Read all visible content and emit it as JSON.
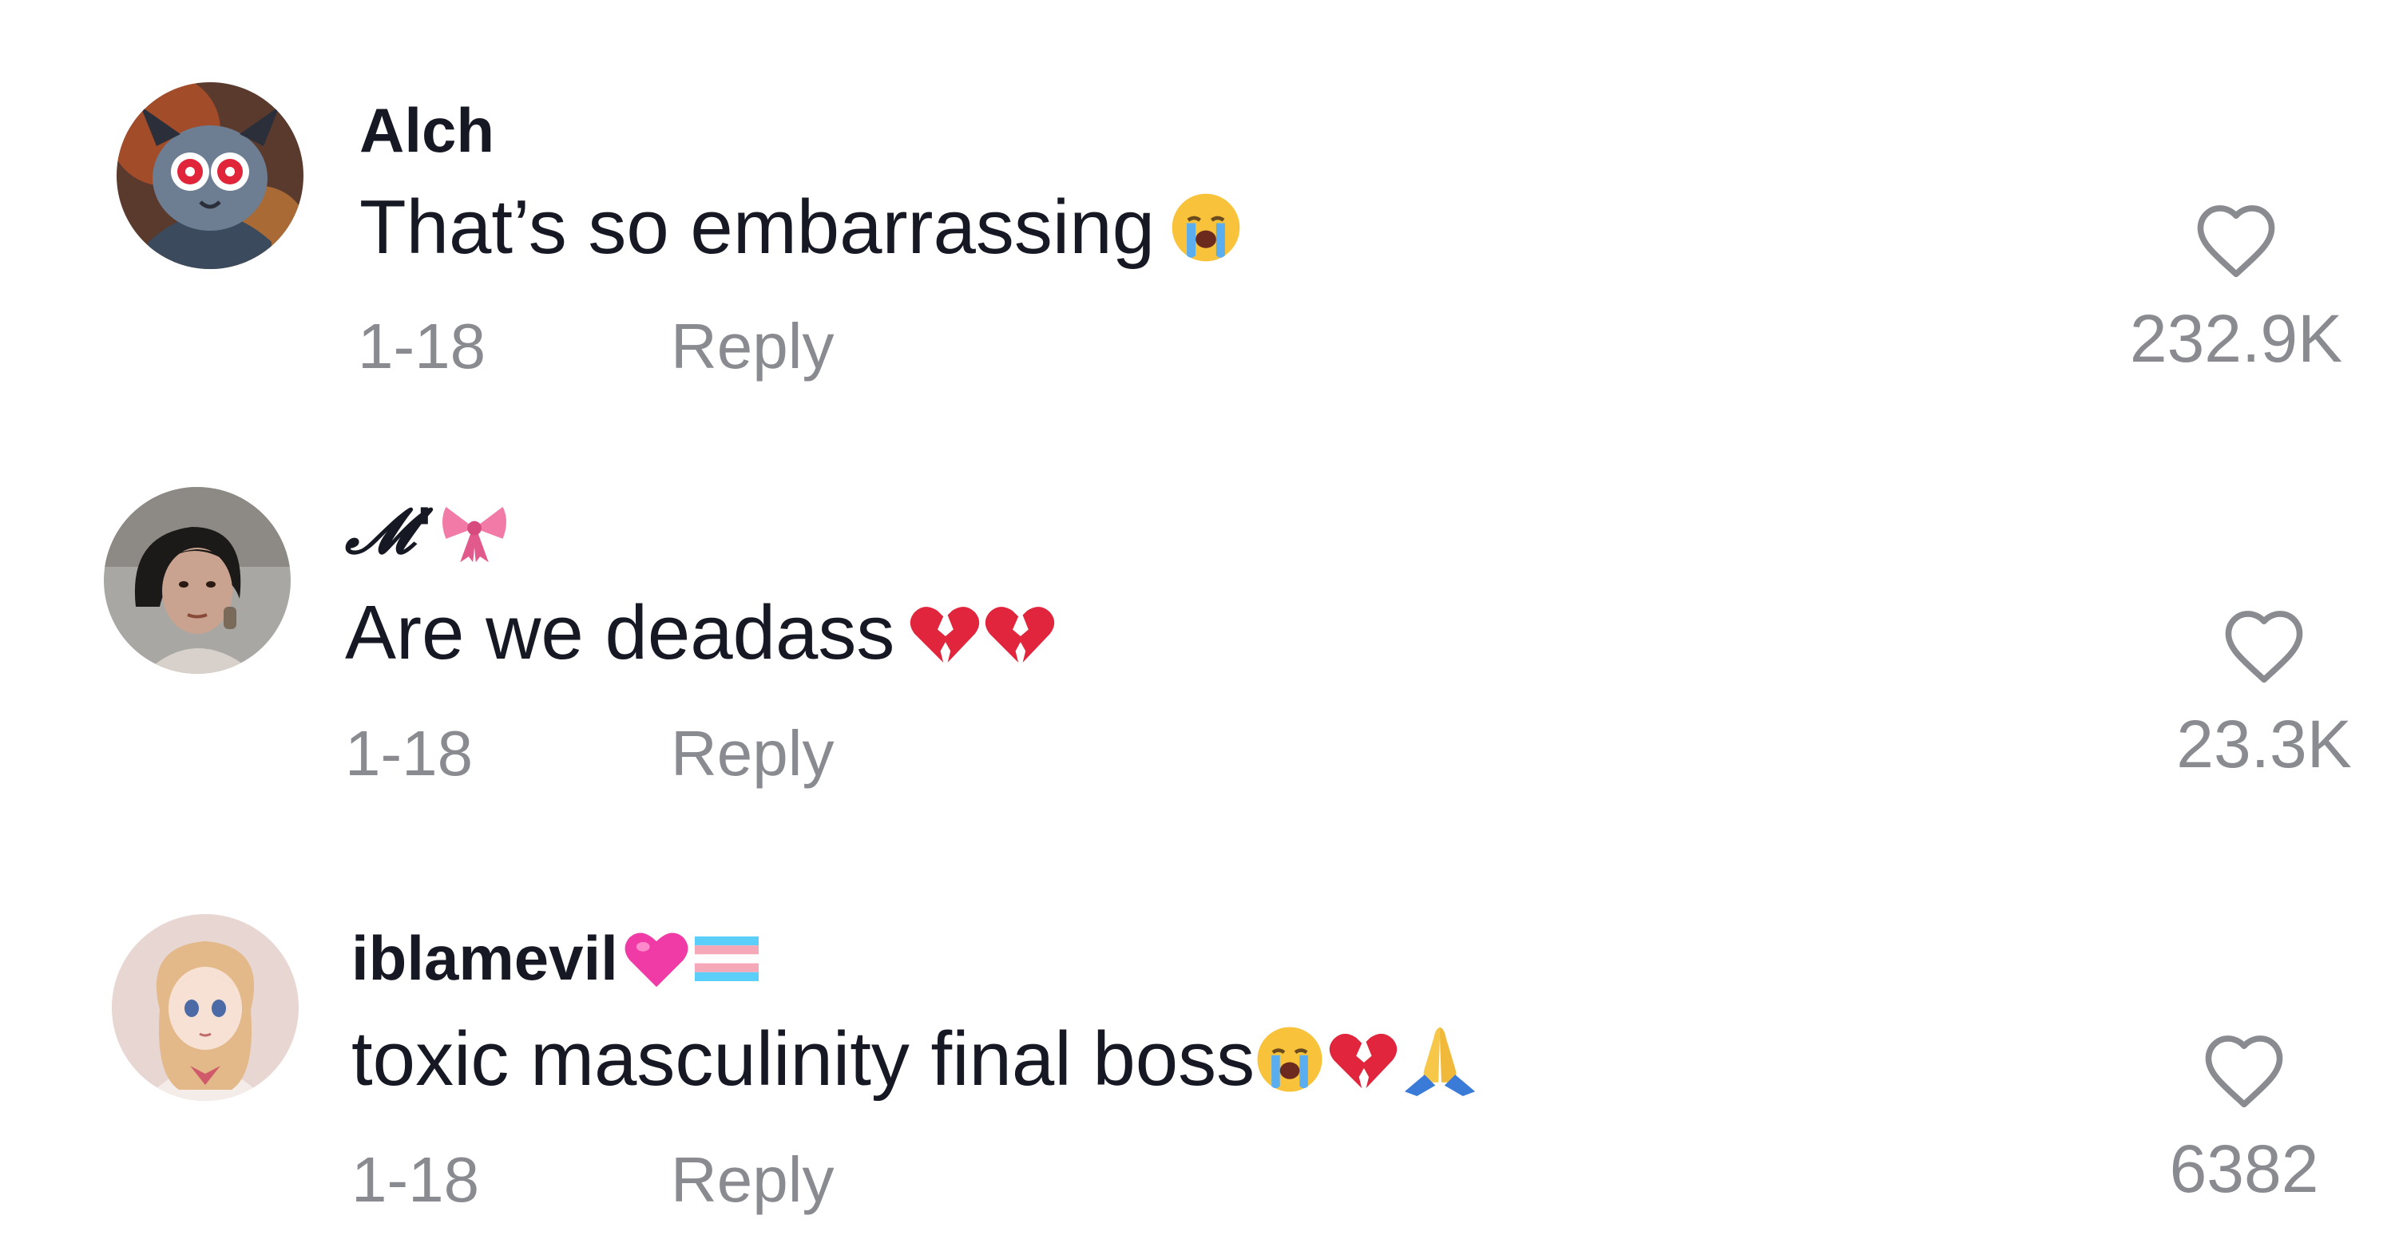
{
  "comments": [
    {
      "username": "Alch",
      "username_emojis": [],
      "text": "That’s so embarrassing",
      "text_emojis": [
        "loudly-crying-face"
      ],
      "date": "1-18",
      "reply_label": "Reply",
      "likes": "232.9K",
      "avatar": "horned-red-eyed-cartoon-character"
    },
    {
      "username": "𝓜'",
      "username_emojis": [
        "ribbon"
      ],
      "text": "Are we deadass",
      "text_emojis": [
        "broken-heart",
        "broken-heart"
      ],
      "date": "1-18",
      "reply_label": "Reply",
      "likes": "23.3K",
      "avatar": "woman-dark-hair-photo"
    },
    {
      "username": "iblamevil",
      "username_emojis": [
        "pink-heart",
        "transgender-flag"
      ],
      "text": "toxic masculinity final boss",
      "text_emojis": [
        "loudly-crying-face",
        "broken-heart",
        "folded-hands"
      ],
      "date": "1-18",
      "reply_label": "Reply",
      "likes": "6382",
      "avatar": "pastel-anime-girl"
    }
  ],
  "colors": {
    "primary_text": "#161823",
    "secondary_text": "#8a8b91",
    "heart_outline": "#8a8b91",
    "background": "#ffffff"
  }
}
